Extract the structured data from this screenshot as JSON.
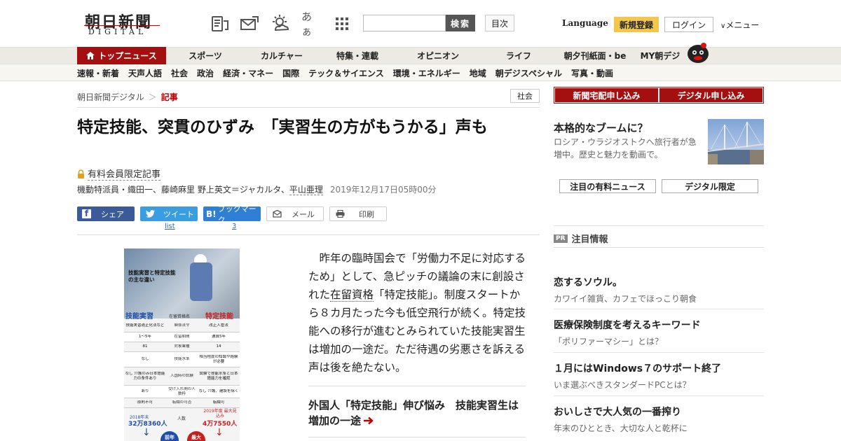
{
  "header": {
    "logo_main": "朝日新聞",
    "logo_sub": "DIGITAL",
    "icons": [
      "newspaper-icon",
      "mail-icon",
      "weather-icon",
      "font-size-icon",
      "apps-grid-icon"
    ],
    "font_size_label": "あぁ",
    "search_button": "検索",
    "index_button": "目次",
    "language": "Language",
    "register": "新規登録",
    "login": "ログイン",
    "menu": "メニュー"
  },
  "nav_primary": [
    "トップニュース",
    "スポーツ",
    "カルチャー",
    "特集・連載",
    "オピニオン",
    "ライフ",
    "朝夕刊紙面・be",
    "MY朝デジ"
  ],
  "nav_secondary": [
    "速報・新着",
    "天声人語",
    "社会",
    "政治",
    "経済・マネー",
    "国際",
    "テック＆サイエンス",
    "環境・エネルギー",
    "地域",
    "朝デジスペシャル",
    "写真・動画"
  ],
  "breadcrumb": {
    "home": "朝日新聞デジタル",
    "sep": "＞",
    "current": "記事"
  },
  "category_badge": "社会",
  "article": {
    "title": "特定技能、突貫のひずみ　「実習生の方がもうかる」声も",
    "members_only": "有料会員限定記事",
    "byline_pre": "機動特派員・織田一、藤崎麻里 野上英文＝ジャカルタ、",
    "byline_link": "平山亜理",
    "date": "2019年12月17日05時00分",
    "share": {
      "facebook": "シェア",
      "twitter": "ツイート",
      "hatena": "ブックマーク",
      "hatena_logo": "B!",
      "mail": "メール",
      "print": "印刷",
      "twitter_count": "list",
      "hatena_count": "3"
    },
    "body_1": "昨年の臨時国会で「労働力不足に対応するため」として、急ピッチの議論の末に創設された",
    "body_link": "在留資格",
    "body_2": "「特定技能」。制度スタートから８カ月たった今も低空飛行が続く。特定技能への移行が進むとみられていた技能実習生は増加の一途だ。ただ待遇の劣悪さを訴える声は後を絶たない。",
    "related": "外国人「特定技能」伸び悩み　技能実習生は増加の一途"
  },
  "figure": {
    "heading": "技能実習と特定技能の主な違い",
    "left": "技能実習",
    "right": "特定技能",
    "col_mid": "在留資格名",
    "rows": [
      [
        "技能実習適正化法など",
        "関係法令",
        "改正入管法"
      ],
      [
        "1～5年",
        "在留期間",
        "通算5年"
      ],
      [
        "81",
        "対象業種",
        "14"
      ],
      [
        "なし",
        "技能水準",
        "相当程度の知識や経験が必要"
      ],
      [
        "なし 介護のみ日本語能力の条件あり",
        "入国時の試験",
        "試験で技能水準と日本語能力を確認"
      ],
      [
        "あり",
        "受け入れ側の人数枠",
        "なし 介護、建設を除く"
      ],
      [
        "原則不可",
        "転職の可否",
        "転職可"
      ]
    ],
    "left_count_label": "2018年末",
    "left_count": "32万8360人",
    "mid_count_label": "人数",
    "right_count_label": "2019年度 最大見込み",
    "right_count": "4万7550人",
    "left_circle": "前年",
    "right_circle": "最大"
  },
  "sidebar": {
    "subscribe_paper": "新聞宅配申し込み",
    "subscribe_digital": "デジタル申し込み",
    "feature_title": "本格的なブームに？",
    "feature_desc": "ロシア・ウラジオストクへ旅行者が急増中。歴史と魅力を動画で。",
    "tab_paid": "注目の有料ニュース",
    "tab_digital": "デジタル限定",
    "pr_badge": "PR",
    "pr_heading": "注目情報",
    "pr_items": [
      {
        "title": "恋するソウル。",
        "desc": "カワイイ雑貨、カフェでほっこり朝食"
      },
      {
        "title": "医療保険制度を考えるキーワード",
        "desc": "「ポリファーマシー」とは？"
      },
      {
        "title": "１月にはWindows７のサポート終了",
        "desc": "いま選ぶべきスタンダードPCとは？"
      },
      {
        "title": "おいしさで大人気の一番搾り",
        "desc": "年末のひととき、大切な人と乾杯に"
      }
    ]
  },
  "colors": {
    "brand_red": "#a40f0f",
    "register_yellow": "#f3c84a",
    "facebook": "#3b5b98",
    "twitter": "#3a9de0",
    "hatena": "#2f7fd4"
  }
}
